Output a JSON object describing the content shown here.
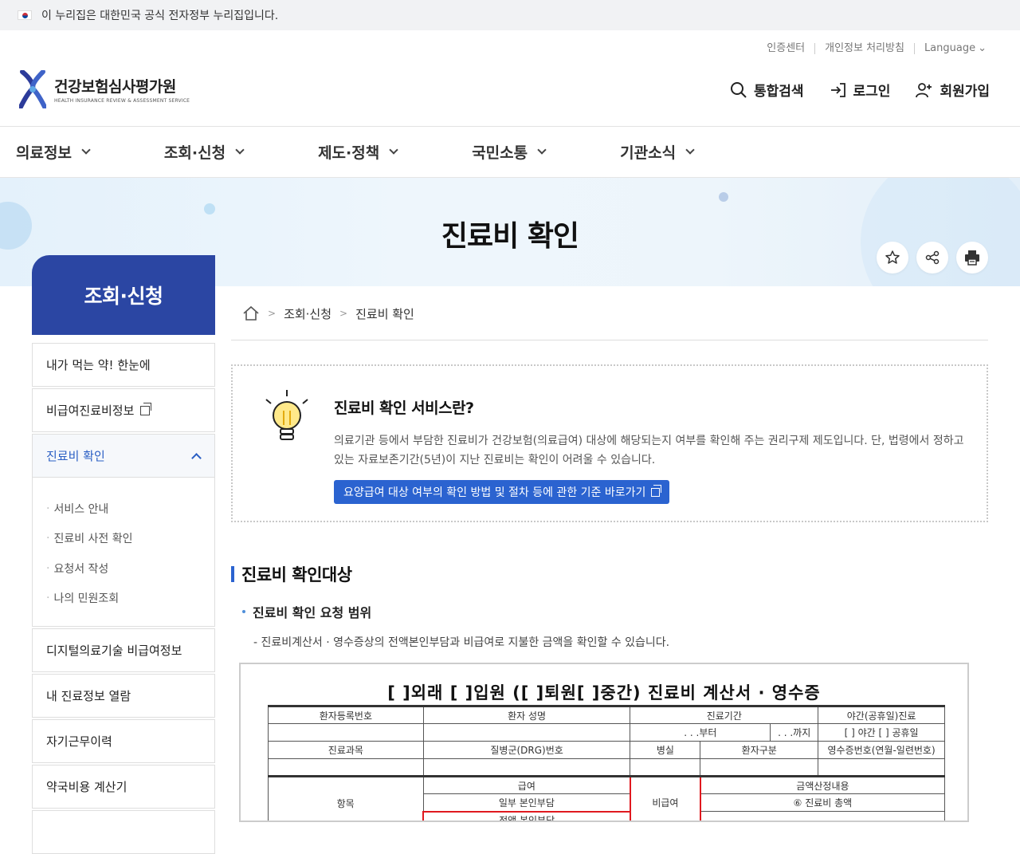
{
  "gov_bar": {
    "text": "이 누리집은 대한민국 공식 전자정부 누리집입니다."
  },
  "util": {
    "cert": "인증센터",
    "privacy": "개인정보 처리방침",
    "language": "Language"
  },
  "logo": {
    "ko": "건강보험심사평가원",
    "en": "HEALTH INSURANCE REVIEW & ASSESSMENT SERVICE"
  },
  "header_actions": {
    "search": "통합검색",
    "login": "로그인",
    "signup": "회원가입"
  },
  "gnb": [
    "의료정보",
    "조회·신청",
    "제도·정책",
    "국민소통",
    "기관소식"
  ],
  "visual": {
    "title": "진료비 확인"
  },
  "sidebar": {
    "title": "조회·신청",
    "items": [
      {
        "label": "내가 먹는 약! 한눈에"
      },
      {
        "label": "비급여진료비정보"
      },
      {
        "label": "진료비 확인"
      },
      {
        "label": "디지털의료기술 비급여정보"
      },
      {
        "label": "내 진료정보 열람"
      },
      {
        "label": "자기근무이력"
      },
      {
        "label": "약국비용 계산기"
      }
    ],
    "sub_items": [
      "서비스 안내",
      "진료비 사전 확인",
      "요청서 작성",
      "나의 민원조회"
    ]
  },
  "breadcrumb": {
    "level1": "조회·신청",
    "level2": "진료비 확인"
  },
  "info": {
    "title": "진료비 확인 서비스란?",
    "desc": "의료기관 등에서 부담한 진료비가 건강보험(의료급여) 대상에 해당되는지 여부를 확인해 주는 권리구제 제도입니다. 단, 법령에서 정하고 있는 자료보존기간(5년)이 지난 진료비는 확인이 어려울 수 있습니다.",
    "button": "요양급여 대상 여부의 확인 방법 및 절차 등에 관한 기준 바로가기"
  },
  "section": {
    "h3": "진료비 확인대상",
    "h4": "진료비 확인 요청 범위",
    "desc": "- 진료비계산서 · 영수증상의 전액본인부담과 비급여로 지불한 금액을 확인할 수 있습니다."
  },
  "receipt": {
    "title": "[ ]외래 [ ]입원 ([ ]퇴원[ ]중간) 진료비 계산서 · 영수증",
    "r1": [
      "환자등록번호",
      "환자 성명",
      "진료기간",
      "야간(공휴일)진료"
    ],
    "r2": [
      ". . .부터",
      ". . .까지",
      "[ ] 야간  [ ] 공휴일"
    ],
    "r3": [
      "진료과목",
      "질병군(DRG)번호",
      "병실",
      "환자구분",
      "영수증번호(연월-일련번호)"
    ],
    "r5": [
      "항목",
      "급여",
      "금액산정내용"
    ],
    "r6": [
      "일부 본인부담",
      "전액 본인부담",
      "비급여",
      "⑥ 진료비 총액"
    ]
  }
}
